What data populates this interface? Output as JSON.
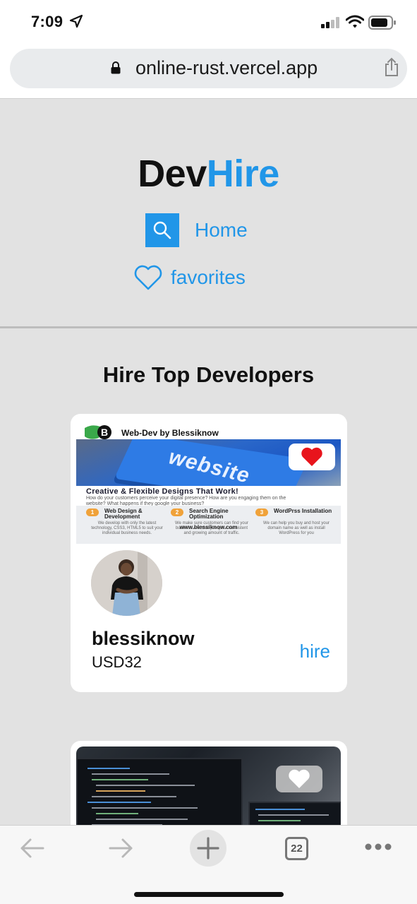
{
  "status_bar": {
    "time": "7:09"
  },
  "browser": {
    "url": "online-rust.vercel.app"
  },
  "site": {
    "logo_part1": "Dev",
    "logo_part2": "Hire",
    "nav": {
      "home": "Home",
      "favorites": "favorites"
    }
  },
  "section": {
    "title": "Hire Top Developers"
  },
  "developers": [
    {
      "name": "blessiknow",
      "price": "USD32",
      "action": "hire",
      "banner": {
        "brand": "Web-Dev  by Blessiknow",
        "hero_word": "website",
        "heading": "Creative & Flexible Designs That Work!",
        "sub": "How do your customers perceive your digital presence? How are you engaging them on the website? What happens if they google your business?",
        "features": [
          {
            "num": "1",
            "title": "Web Design & Development",
            "body": "We develop with only the latest technology, CSS3, HTML5 to suit your individual business needs."
          },
          {
            "num": "2",
            "title": "Search Engine Optimization",
            "body": "We make sure customers can find your business and that you get a consistent and growing amount of traffic."
          },
          {
            "num": "3",
            "title": "WordPrss Installation",
            "body": "We can help you buy and host your domain name as well as install WordPress for you"
          }
        ],
        "url": "www.blessiknow.com"
      },
      "favorited": true
    },
    {
      "favorited": false
    }
  ],
  "toolbar": {
    "tab_count": "22"
  },
  "colors": {
    "accent": "#2196e8",
    "heart_active": "#e8141c",
    "heart_inactive": "#ffffff"
  }
}
